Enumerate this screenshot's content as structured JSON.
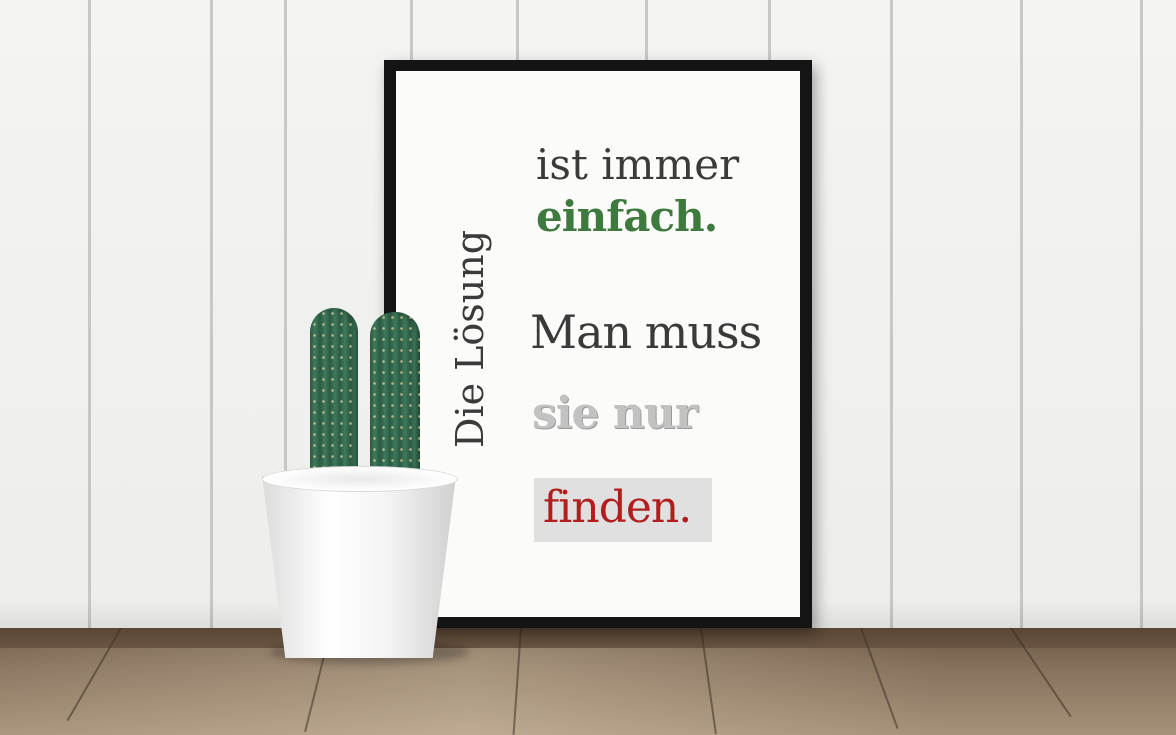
{
  "poster": {
    "vertical_text": "Die Lösung",
    "line1": "ist immer",
    "line2": "einfach.",
    "line3": "Man muss",
    "line4": "sie nur",
    "line5": "finden."
  },
  "colors": {
    "accent_green": "#3e7a3e",
    "accent_red": "#b21d1d",
    "text_dark": "#3a3a3a",
    "frame": "#141414"
  }
}
